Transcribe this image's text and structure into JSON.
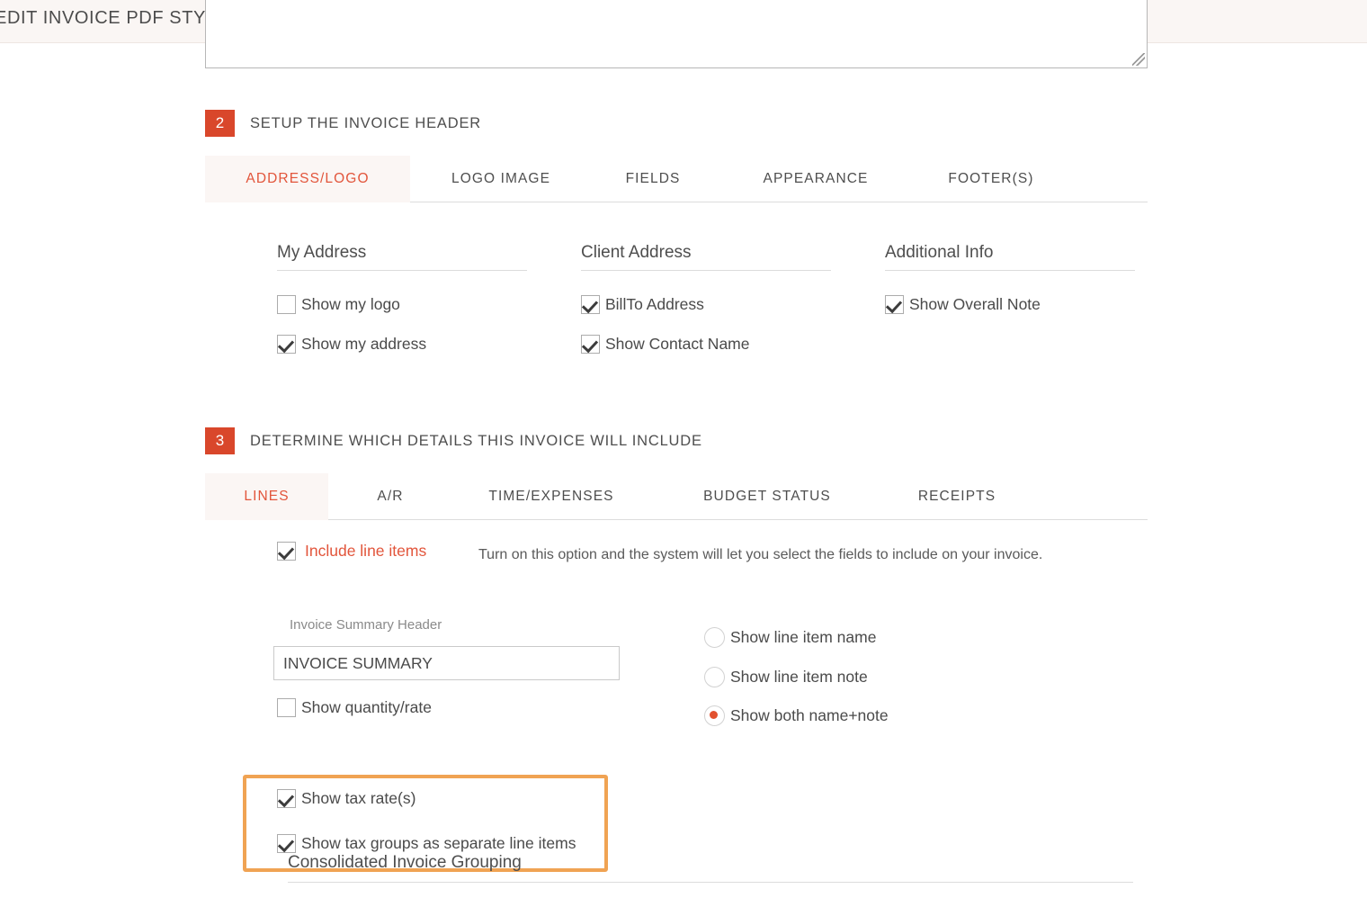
{
  "window": {
    "title": "EDIT INVOICE PDF STYLE"
  },
  "colors": {
    "accent": "#E2553B",
    "badge": "#D9472B",
    "highlight_border": "#F0A353",
    "header_bg": "#FAF6F4",
    "active_tab_bg": "#FBF6F4"
  },
  "top_field": {
    "value": "",
    "placeholder": ""
  },
  "section_header": {
    "number": "2",
    "title": "SETUP THE INVOICE HEADER",
    "tabs": [
      {
        "label": "ADDRESS/LOGO",
        "active": true
      },
      {
        "label": "LOGO IMAGE",
        "active": false
      },
      {
        "label": "FIELDS",
        "active": false
      },
      {
        "label": "APPEARANCE",
        "active": false
      },
      {
        "label": "FOOTER(S)",
        "active": false
      }
    ],
    "columns": [
      {
        "heading": "My Address",
        "options": [
          {
            "label": "Show my logo",
            "checked": false
          },
          {
            "label": "Show my address",
            "checked": true
          }
        ]
      },
      {
        "heading": "Client Address",
        "options": [
          {
            "label": "BillTo Address",
            "checked": true
          },
          {
            "label": "Show Contact Name",
            "checked": true
          }
        ]
      },
      {
        "heading": "Additional Info",
        "options": [
          {
            "label": "Show Overall Note",
            "checked": true
          }
        ]
      }
    ]
  },
  "section_details": {
    "number": "3",
    "title": "DETERMINE WHICH DETAILS THIS INVOICE WILL INCLUDE",
    "tabs": [
      {
        "label": "LINES",
        "active": true
      },
      {
        "label": "A/R",
        "active": false
      },
      {
        "label": "TIME/EXPENSES",
        "active": false
      },
      {
        "label": "BUDGET STATUS",
        "active": false
      },
      {
        "label": "RECEIPTS",
        "active": false
      }
    ],
    "include_line_items": {
      "label": "Include line items",
      "checked": true,
      "description": "Turn on this option and the system will let you select the fields to include on your invoice."
    },
    "summary_header": {
      "label": "Invoice Summary Header",
      "value": "INVOICE SUMMARY",
      "placeholder": "Invoice Summary Header"
    },
    "show_quantity_rate": {
      "label": "Show quantity/rate",
      "checked": false
    },
    "tax_group": {
      "highlighted": true,
      "options": [
        {
          "label": "Show tax rate(s)",
          "checked": true
        },
        {
          "label": "Show tax groups as separate line items",
          "checked": true
        }
      ]
    },
    "line_item_display": {
      "options": [
        {
          "label": "Show line item name",
          "selected": false
        },
        {
          "label": "Show line item note",
          "selected": false
        },
        {
          "label": "Show both name+note",
          "selected": true
        }
      ]
    },
    "consolidated_grouping": {
      "heading": "Consolidated Invoice Grouping"
    }
  }
}
